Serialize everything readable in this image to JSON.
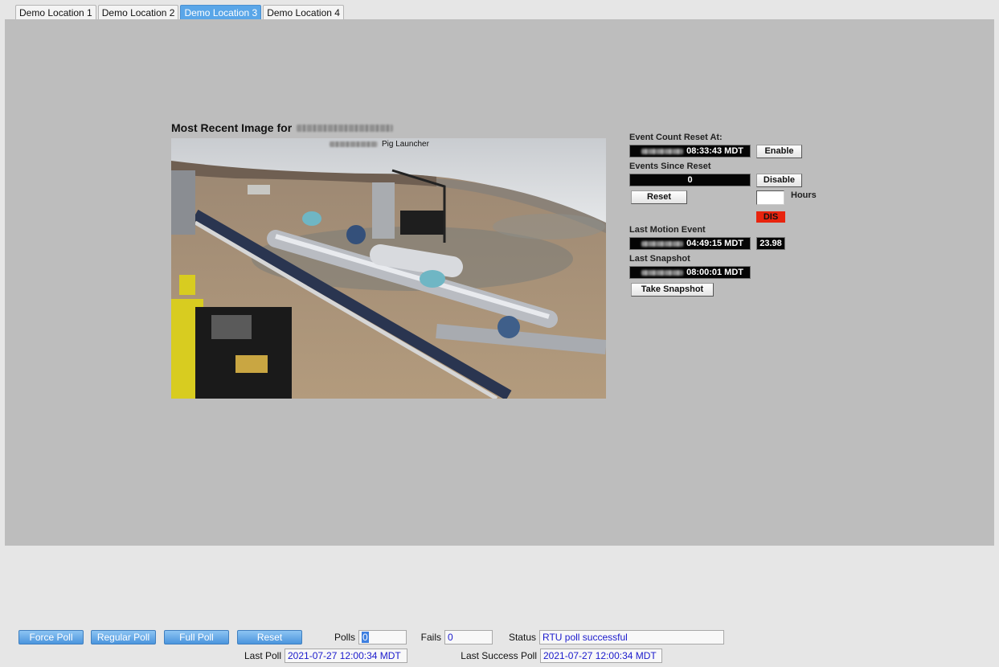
{
  "tabs": [
    "Demo Location 1",
    "Demo Location 2",
    "Demo Location 3",
    "Demo Location 4"
  ],
  "active_tab": 2,
  "image_panel": {
    "title": "Most Recent Image for",
    "caption_suffix": "Pig Launcher"
  },
  "controls": {
    "event_count_reset_label": "Event Count Reset At:",
    "event_count_reset_time": "08:33:43 MDT",
    "enable_label": "Enable",
    "events_since_reset_label": "Events Since Reset",
    "events_since_reset_value": "0",
    "disable_label": "Disable",
    "reset_label": "Reset",
    "hours_label": "Hours",
    "hours_value": "",
    "status_badge": "DIS",
    "last_motion_label": "Last Motion Event",
    "last_motion_time": "04:49:15 MDT",
    "last_motion_value": "23.98",
    "last_snapshot_label": "Last Snapshot",
    "last_snapshot_time": "08:00:01 MDT",
    "take_snapshot_label": "Take Snapshot"
  },
  "poll_bar": {
    "force_poll": "Force Poll",
    "regular_poll": "Regular Poll",
    "full_poll": "Full Poll",
    "reset": "Reset",
    "polls_label": "Polls",
    "polls_value": "0",
    "fails_label": "Fails",
    "fails_value": "0",
    "status_label": "Status",
    "status_value": "RTU poll successful",
    "last_poll_label": "Last Poll",
    "last_poll_value": "2021-07-27 12:00:34 MDT",
    "last_success_label": "Last Success Poll",
    "last_success_value": "2021-07-27 12:00:34 MDT"
  },
  "colors": {
    "active_tab": "#5aa6e8",
    "panel_bg": "#bdbdbd",
    "status_badge_bg": "#e8240e",
    "value_text": "#1a1acc"
  }
}
